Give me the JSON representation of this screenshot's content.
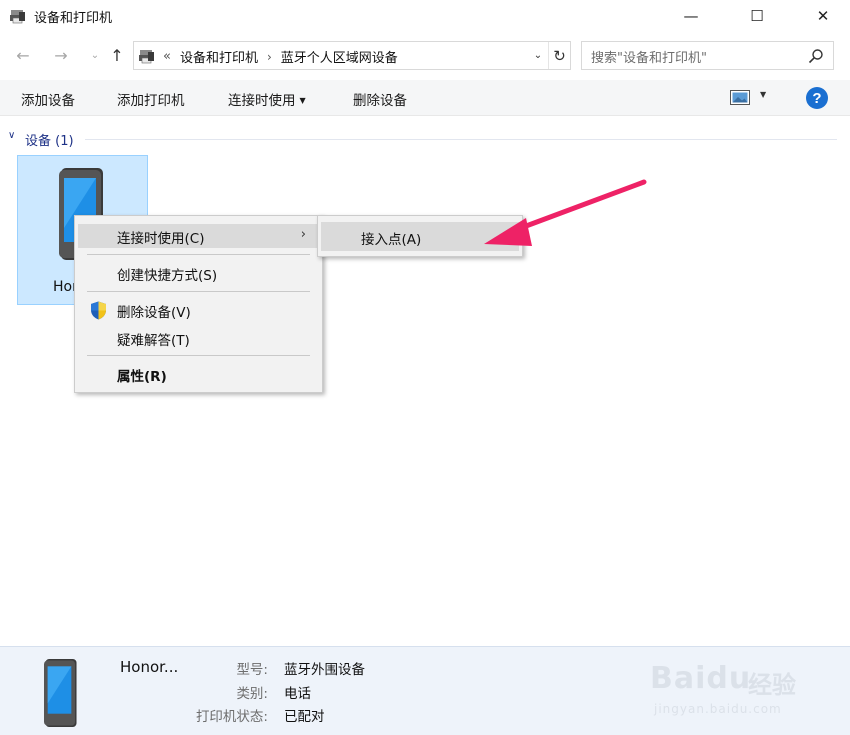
{
  "window": {
    "title": "设备和打印机",
    "minimize": "—",
    "maximize": "☐",
    "close": "✕"
  },
  "nav": {
    "back": "←",
    "forward": "→",
    "recent": "⌄",
    "up": "↑",
    "laquo": "«",
    "breadcrumbs": [
      "设备和打印机",
      "蓝牙个人区域网设备"
    ],
    "separator": "›",
    "dropdown": "⌄",
    "refresh": "↻",
    "search_placeholder": "搜索\"设备和打印机\""
  },
  "toolbar": {
    "add_device": "添加设备",
    "add_printer": "添加打印机",
    "connect_using": "连接时使用",
    "caret": "▼",
    "remove_device": "删除设备",
    "help": "?"
  },
  "group": {
    "chevron": "∨",
    "label": "设备 (1)"
  },
  "device": {
    "name": "Honor..."
  },
  "context_menu": {
    "items": [
      {
        "label": "连接时使用(C)",
        "arrow": "›"
      },
      {
        "label": "创建快捷方式(S)"
      },
      {
        "label": "删除设备(V)"
      },
      {
        "label": "疑难解答(T)"
      },
      {
        "label": "属性(R)"
      }
    ],
    "submenu": {
      "items": [
        {
          "label": "接入点(A)"
        }
      ]
    }
  },
  "details": {
    "name": "Honor...",
    "rows": [
      {
        "key": "型号:",
        "value": "蓝牙外围设备"
      },
      {
        "key": "类别:",
        "value": "电话"
      },
      {
        "key": "打印机状态:",
        "value": "已配对"
      }
    ]
  },
  "watermark": {
    "brand": "Baidu",
    "brand_cn": "经验",
    "url": "jingyan.baidu.com"
  },
  "colors": {
    "accent": "#1a6fd1",
    "annotation_arrow": "#ee2266",
    "selection": "#cce8ff"
  }
}
